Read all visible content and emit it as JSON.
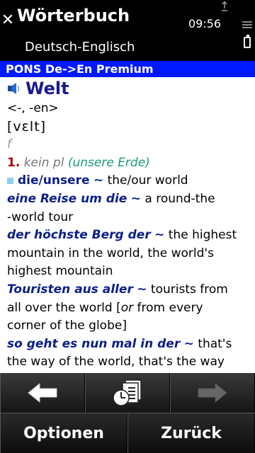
{
  "status": {
    "app_title": "Wörterbuch",
    "subtitle": "Deutsch-Englisch",
    "time": "09:56"
  },
  "dictionary_bar": "PONS De->En Premium",
  "entry": {
    "headword": "Welt",
    "grammar": "<-, -en>",
    "phonetic": "[vɛlt]",
    "gender": "f",
    "sense_number": "1.",
    "sense_label": "kein pl",
    "sense_gloss": "(unsere Erde)",
    "examples": [
      {
        "de": "die/unsere",
        "tilde": "~",
        "en": "the/our world"
      },
      {
        "de": "eine Reise um die",
        "tilde": "~",
        "en": "a round-the"
      },
      {
        "en_cont": "-world tour"
      },
      {
        "de": "der höchste Berg der",
        "tilde": "~",
        "en": "the highest"
      },
      {
        "en_cont": "mountain in the world, the world's"
      },
      {
        "en_cont": "highest mountain"
      },
      {
        "de": "Touristen aus aller",
        "tilde": "~",
        "en": "tourists from"
      },
      {
        "en_cont_a": "all over the world [",
        "or": "or",
        "en_cont_b": "from every"
      },
      {
        "en_cont": "corner of the globe]"
      },
      {
        "de": "so geht es nun mal in der",
        "tilde": "~",
        "en": "that's"
      },
      {
        "en_cont": "the way of the world, that's the way"
      }
    ]
  },
  "toolbar": {
    "back_icon": "arrow-left-icon",
    "history_icon": "history-icon",
    "forward_icon": "arrow-right-icon"
  },
  "softkeys": {
    "left": "Optionen",
    "right": "Zurück"
  },
  "colors": {
    "dictionary_bar": "#0018ff",
    "headword": "#1a1a8e",
    "german_phrase": "#0b1f86",
    "sense_number": "#aa0000",
    "sense_gloss": "#179b80"
  }
}
